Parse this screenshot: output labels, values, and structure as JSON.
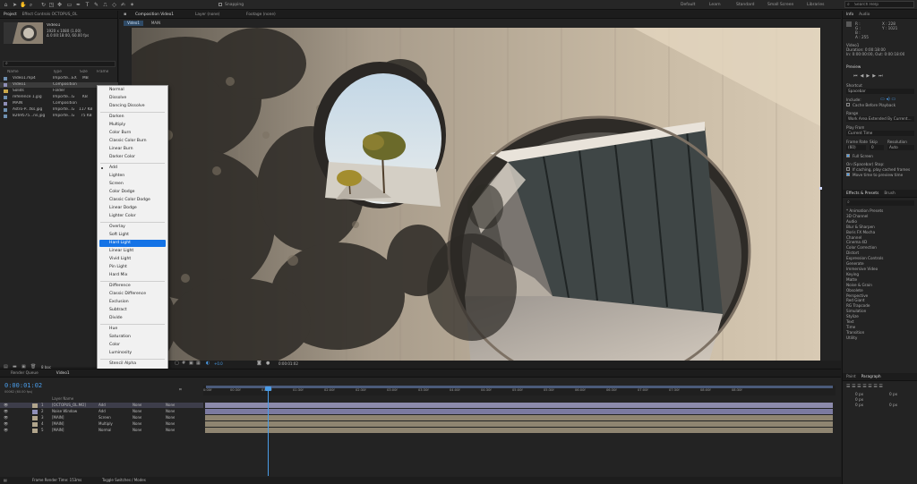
{
  "toolbar": {
    "snapping": "Snapping",
    "workspaces": [
      "Default",
      "Learn",
      "Standard",
      "Small Screen",
      "Libraries"
    ],
    "active_workspace": "Standard",
    "search_placeholder": "Search Help"
  },
  "project": {
    "tabs": [
      "Project",
      "Effect Controls OCTOPUS_OL"
    ],
    "selected_name": "Video1",
    "selected_info1": "1920 x 1080 (1.00)",
    "selected_info2": "Δ 0:00:18:00, 60.00 fps",
    "columns": [
      "Name",
      "Type",
      "Size",
      "Frame"
    ],
    "items": [
      {
        "name": "Video1.mp4",
        "type": "Importe...EX",
        "size": "MB"
      },
      {
        "name": "Video1",
        "type": "Composition",
        "size": ""
      },
      {
        "name": "Solids",
        "type": "Folder",
        "size": ""
      },
      {
        "name": "reference 1.jpg",
        "type": "Importe...G",
        "size": "KB"
      },
      {
        "name": "MAIN",
        "type": "Composition",
        "size": ""
      },
      {
        "name": "Astro-P...tks.jpg",
        "type": "Importe...G",
        "size": "117 KB"
      },
      {
        "name": "8269575...ns.jpg",
        "type": "Importe...G",
        "size": "75 KB"
      }
    ],
    "bpc": "8 bpc"
  },
  "viewer": {
    "panel_label": "Composition Video1",
    "layer_label": "Layer (none)",
    "footage_label": "Footage (none)",
    "sub_tabs": [
      "Video1",
      "MAIN"
    ],
    "zoom": "(Full)",
    "timecode": "0:00:01:02",
    "exposure": "+0.0"
  },
  "blend_menu": {
    "groups": [
      [
        "Normal",
        "Dissolve",
        "Dancing Dissolve"
      ],
      [
        "Darken",
        "Multiply",
        "Color Burn",
        "Classic Color Burn",
        "Linear Burn",
        "Darker Color"
      ],
      [
        "Add",
        "Lighten",
        "Screen",
        "Color Dodge",
        "Classic Color Dodge",
        "Linear Dodge",
        "Lighter Color"
      ],
      [
        "Overlay",
        "Soft Light",
        "Hard Light",
        "Linear Light",
        "Vivid Light",
        "Pin Light",
        "Hard Mix"
      ],
      [
        "Difference",
        "Classic Difference",
        "Exclusion",
        "Subtract",
        "Divide"
      ],
      [
        "Hue",
        "Saturation",
        "Color",
        "Luminosity"
      ],
      [
        "Stencil Alpha",
        "Stencil Luma",
        "Silhouette Alpha",
        "Silhouette Luma"
      ],
      [
        "Alpha Add",
        "Luminescent Premul"
      ]
    ],
    "checked": "Add",
    "highlighted": "Hard Light"
  },
  "info_panel": {
    "tabs": [
      "Info",
      "Audio"
    ],
    "r": "R :",
    "g": "G :",
    "b": "B :",
    "a": "A : 255",
    "x": "X : 228",
    "y": "Y : 1021",
    "clip_name": "Video1",
    "duration": "Duration: 0:00:18:00",
    "in_out": "In: 0:00:00:00, Out: 0:00:18:00"
  },
  "preview": {
    "title": "Preview",
    "shortcut_label": "Shortcut",
    "shortcut_value": "Spacebar",
    "include_label": "Include:",
    "cache_label": "Cache Before Playback",
    "range_label": "Range",
    "range_value": "Work Area Extended By Current...",
    "play_from_label": "Play From",
    "play_from_value": "Current Time",
    "frame_rate_label": "Frame Rate",
    "skip_label": "Skip",
    "resolution_label": "Resolution",
    "frame_rate_value": "(60)",
    "skip_value": "0",
    "resolution_value": "Auto",
    "full_screen": "Full Screen",
    "on_stop": "On (Spacebar) Stop:",
    "opt1": "If caching, play cached frames",
    "opt2": "Move time to preview time"
  },
  "effects": {
    "tabs": [
      "Effects & Presets",
      "Brush"
    ],
    "items": [
      "* Animation Presets",
      "3D Channel",
      "Audio",
      "Blur & Sharpen",
      "Boris FX Mocha",
      "Channel",
      "Cinema 4D",
      "Color Correction",
      "Distort",
      "Expression Controls",
      "Generate",
      "Immersive Video",
      "Keying",
      "Matte",
      "Noise & Grain",
      "Obsolete",
      "Perspective",
      "Red Giant",
      "RG Trapcode",
      "Simulation",
      "Stylize",
      "Text",
      "Time",
      "Transition",
      "Utility"
    ]
  },
  "paragraph": {
    "tabs": [
      "Paint",
      "Paragraph"
    ],
    "v1": "0 px",
    "v2": "0 px",
    "v3": "0 px",
    "v4": "0 px",
    "v5": "0 px"
  },
  "timeline": {
    "tabs": [
      "Render Queue",
      "Video1"
    ],
    "timecode": "0:00:01:02",
    "timecode_sub": "00062 (60.00 fps)",
    "col_layer": "Layer Name",
    "ruler": [
      "0:00f",
      "00:30f",
      "01:00f",
      "01:30f",
      "02:00f",
      "02:30f",
      "03:00f",
      "03:30f",
      "04:00f",
      "04:30f",
      "05:00f",
      "05:30f",
      "06:00f",
      "06:30f",
      "07:00f",
      "07:30f",
      "08:00f",
      "08:30f"
    ],
    "layers": [
      {
        "num": "1",
        "name": "[OCTOPUS_OL.MO]",
        "mode": "Add",
        "trk": "None",
        "parent": "None"
      },
      {
        "num": "2",
        "name": "Noise Window",
        "mode": "Add",
        "trk": "None",
        "parent": "None"
      },
      {
        "num": "3",
        "name": "[MAIN]",
        "mode": "Screen",
        "trk": "None",
        "parent": "None"
      },
      {
        "num": "4",
        "name": "[MAIN]",
        "mode": "Multiply",
        "trk": "None",
        "parent": "None"
      },
      {
        "num": "5",
        "name": "[MAIN]",
        "mode": "Normal",
        "trk": "None",
        "parent": "None"
      }
    ],
    "footer": "Frame Render Time: 153ms",
    "footer_toggle": "Toggle Switches / Modes"
  }
}
